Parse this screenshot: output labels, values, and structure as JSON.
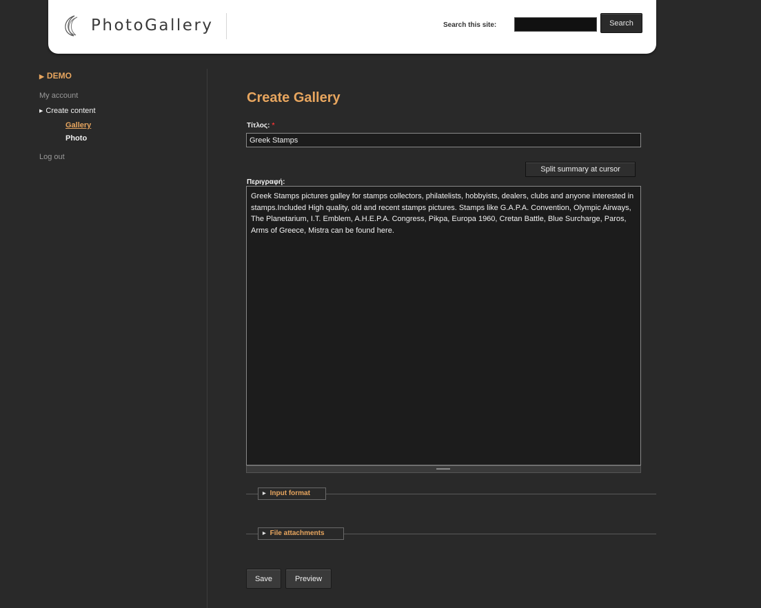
{
  "header": {
    "logo_text": "PhotoGallery",
    "search_label": "Search this site:",
    "search_value": "",
    "search_button": "Search"
  },
  "sidebar": {
    "user": "DEMO",
    "my_account": "My account",
    "create_content": "Create content",
    "gallery": "Gallery",
    "photo": "Photo",
    "log_out": "Log out"
  },
  "form": {
    "page_title": "Create Gallery",
    "title_label": "Τίτλος:",
    "required_mark": "*",
    "title_value": "Greek Stamps",
    "split_button": "Split summary at cursor",
    "description_label": "Περιγραφή:",
    "description_value": "Greek Stamps pictures galley for stamps collectors, philatelists, hobbyists, dealers, clubs and anyone interested in stamps.Included High quality, old and recent stamps pictures. Stamps like G.A.P.A. Convention, Olympic Airways, The Planetarium, I.T. Emblem, A.H.E.P.A. Congress, Pikpa, Europa 1960, Cretan Battle, Blue Surcharge, Paros, Arms of Greece, Mistra can be found here.",
    "input_format_legend": "Input format",
    "file_attachments_legend": "File attachments",
    "save_button": "Save",
    "preview_button": "Preview"
  },
  "colors": {
    "accent": "#e8a65f",
    "background": "#292929",
    "field_background": "#1c1c1c"
  }
}
